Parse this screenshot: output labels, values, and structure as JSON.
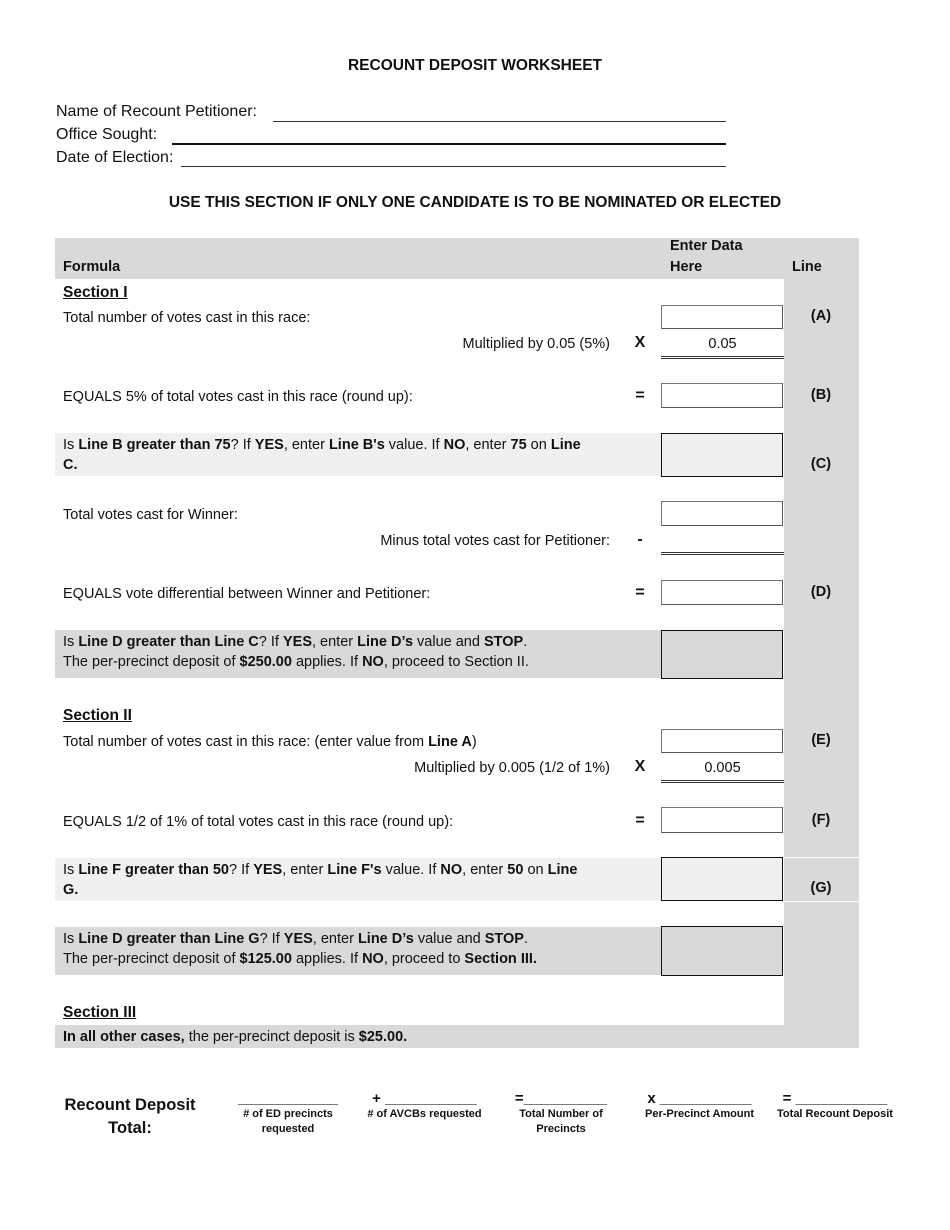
{
  "title": "RECOUNT DEPOSIT WORKSHEET",
  "header_fields": [
    {
      "label": "Name of Recount Petitioner:",
      "value": ""
    },
    {
      "label": "Office Sought:",
      "value": ""
    },
    {
      "label": "Date of Election:",
      "value": ""
    }
  ],
  "subtitle": "USE THIS SECTION IF ONLY ONE CANDIDATE IS TO BE NOMINATED OR ELECTED",
  "columns": {
    "formula": "Formula",
    "enter_data_1": "Enter Data",
    "enter_data_2": "Here",
    "line": "Line"
  },
  "section1": {
    "heading": "Section I",
    "row_a": {
      "text": "Total number of votes cast in this race:",
      "line": "(A)",
      "value": ""
    },
    "mult": {
      "text": "Multiplied by 0.05 (5%)",
      "op": "X",
      "value": "0.05"
    },
    "row_b": {
      "text": "EQUALS 5% of total votes cast in this race (round up):",
      "op": "=",
      "line": "(B)",
      "value": ""
    },
    "row_c": {
      "p1": "Is ",
      "b1": "Line B greater than 75",
      "p2": "?  If ",
      "b2": "YES",
      "p3": ", enter ",
      "b3": "Line B's",
      "p4": " value.  If ",
      "b4": "NO",
      "p5": ", enter ",
      "b5": "75",
      "p6": " on ",
      "b6": "Line",
      "b7": "C.",
      "line": "(C)",
      "value": ""
    },
    "winner": {
      "text": "Total votes cast for Winner:",
      "value": ""
    },
    "minus": {
      "text": "Minus total votes cast for Petitioner:",
      "op": "-",
      "value": ""
    },
    "row_d": {
      "text": "EQUALS vote differential between Winner and Petitioner:",
      "op": "=",
      "line": "(D)",
      "value": ""
    },
    "check": {
      "p1": "Is ",
      "b1": "Line D greater than Line C",
      "p2": "?  If ",
      "b2": "YES",
      "p3": ", enter ",
      "b3": "Line D’s",
      "p4": " value and ",
      "b4": "STOP",
      "p5": ".",
      "q1": "The per-precinct deposit of ",
      "qb1": "$250.00",
      "q2": " applies.  If ",
      "qb2": "NO",
      "q3": ", proceed to Section II.",
      "value": ""
    }
  },
  "section2": {
    "heading": "Section II",
    "row_e": {
      "text": "Total number of votes cast in this race: (enter value from ",
      "bold": "Line A",
      "tail": ")",
      "line": "(E)",
      "value": ""
    },
    "mult": {
      "text": "Multiplied by 0.005 (1/2 of 1%)",
      "op": "X",
      "value": "0.005"
    },
    "row_f": {
      "text": "EQUALS 1/2 of 1% of total votes cast in this race (round up):",
      "op": "=",
      "line": "(F)",
      "value": ""
    },
    "row_g": {
      "p1": "Is ",
      "b1": "Line F greater than 50",
      "p2": "?  If ",
      "b2": "YES",
      "p3": ", enter ",
      "b3": "Line F's",
      "p4": " value.  If ",
      "b4": "NO",
      "p5": ", enter ",
      "b5": "50",
      "p6": " on ",
      "b6": "Line",
      "b7": "G.",
      "line": "(G)",
      "value": ""
    },
    "check": {
      "p1": "Is ",
      "b1": "Line D greater than Line G",
      "p2": "?  If ",
      "b2": "YES",
      "p3": ", enter ",
      "b3": "Line D’s",
      "p4": " value and ",
      "b4": "STOP",
      "p5": ".",
      "q1": "The per-precinct deposit of ",
      "qb1": "$125.00",
      "q2": " applies.   If ",
      "qb2": "NO",
      "q3": ", proceed to ",
      "qb3": "Section III.",
      "value": ""
    }
  },
  "section3": {
    "heading": "Section III",
    "b1": "In all other cases,",
    "p1": " the per-precinct deposit is ",
    "b2": "$25.00."
  },
  "total": {
    "label_1": "Recount Deposit",
    "label_2": "Total:",
    "blanks": [
      {
        "prefix": "",
        "line": "____________",
        "caption_1": "# of ED precincts",
        "caption_2": "requested"
      },
      {
        "prefix": "+ ",
        "line": "___________",
        "caption_1": "# of AVCBs requested",
        "caption_2": ""
      },
      {
        "prefix": "=",
        "line": "__________",
        "caption_1": "Total Number of",
        "caption_2": "Precincts"
      },
      {
        "prefix": "x ",
        "line": "___________",
        "caption_1": "Per-Precinct Amount",
        "caption_2": ""
      },
      {
        "prefix": "= ",
        "line": "___________",
        "caption_1": "Total Recount Deposit",
        "caption_2": ""
      }
    ]
  }
}
